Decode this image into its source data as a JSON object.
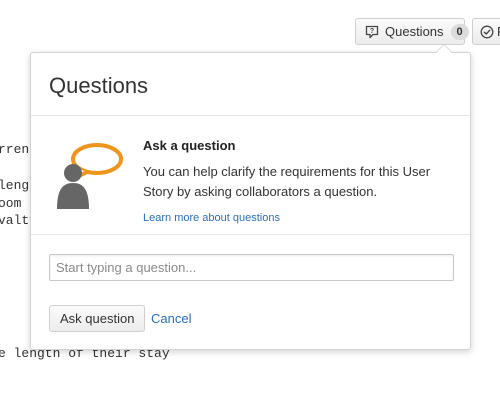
{
  "background_text": [
    "rrent",
    "leng",
    "oom",
    "valty",
    "e length of their stay"
  ],
  "toolbar": {
    "questions_label": "Questions",
    "questions_count": "0",
    "questions_icon": "question-bubble-icon",
    "follow_label": "F",
    "follow_icon": "check-circle-icon"
  },
  "popover": {
    "title": "Questions",
    "heading": "Ask a question",
    "description": "You can help clarify the requirements for this User Story by asking collaborators a question.",
    "learn_link": "Learn more about questions",
    "input_placeholder": "Start typing a question...",
    "input_value": "",
    "ask_button": "Ask question",
    "cancel_link": "Cancel",
    "illustration_icon": "person-speech-bubble-icon"
  },
  "colors": {
    "accent_orange": "#f0951c",
    "link_blue": "#2a6ebb",
    "figure_gray": "#666666"
  }
}
